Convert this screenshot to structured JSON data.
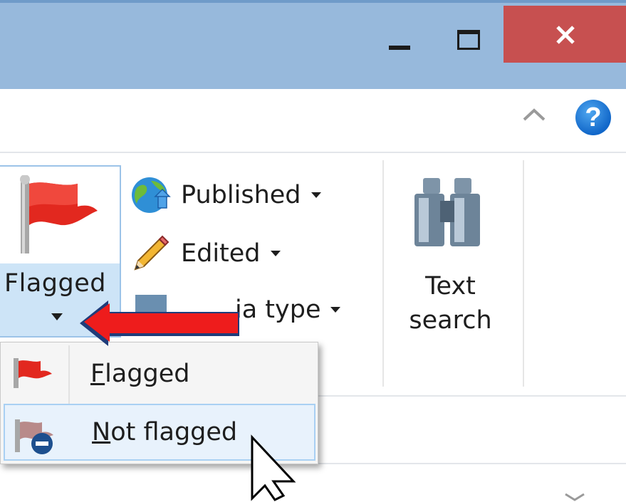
{
  "window": {
    "minimize_glyph": "minimize-icon",
    "maximize_glyph": "maximize-icon",
    "close_glyph": "close-icon",
    "close_color": "#c75050",
    "titlebar_color": "#97b9dc"
  },
  "ribbon": {
    "help_label": "?",
    "flagged_button_label": "Flagged",
    "published_label": "Published",
    "edited_label": "Edited",
    "media_type_label": "ia type",
    "text_search_label_line1": "Text",
    "text_search_label_line2": "search"
  },
  "flag_menu": {
    "items": [
      {
        "label": "Flagged",
        "accelerator": "F",
        "rest": "lagged",
        "icon": "red-flag-icon",
        "highlighted": false
      },
      {
        "label": "Not flagged",
        "accelerator": "N",
        "rest": "ot flagged",
        "icon": "flag-remove-icon",
        "highlighted": true
      }
    ]
  },
  "annotation": {
    "arrow_color": "#ee1c1c",
    "arrow_icon": "red-arrow-annotation"
  }
}
